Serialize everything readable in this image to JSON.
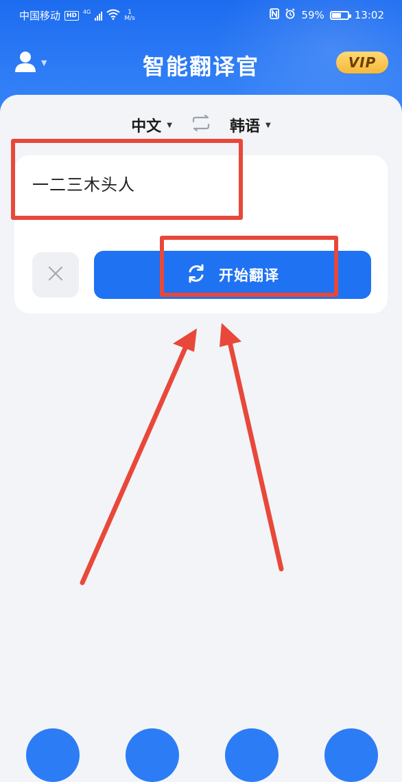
{
  "status_bar": {
    "carrier": "中国移动",
    "hd_badge": "HD",
    "net_type": "4G",
    "speed_value": "1",
    "speed_unit": "M/s",
    "battery_percent": "59%",
    "battery_level": 0.59,
    "time": "13:02"
  },
  "header": {
    "title": "智能翻译官",
    "vip_label": "VIP"
  },
  "language_bar": {
    "source_lang": "中文",
    "target_lang": "韩语"
  },
  "input": {
    "text": "一二三木头人"
  },
  "actions": {
    "translate_label": "开始翻译"
  },
  "colors": {
    "primary": "#1f72f2",
    "vip_gold": "#f5b93b",
    "annotation_red": "#e8483a",
    "background": "#f2f4f7"
  },
  "icons": [
    "user-icon",
    "swap-icon",
    "clear-icon",
    "refresh-icon",
    "nfc-icon",
    "alarm-icon",
    "wifi-icon",
    "signal-icon",
    "battery-icon"
  ]
}
